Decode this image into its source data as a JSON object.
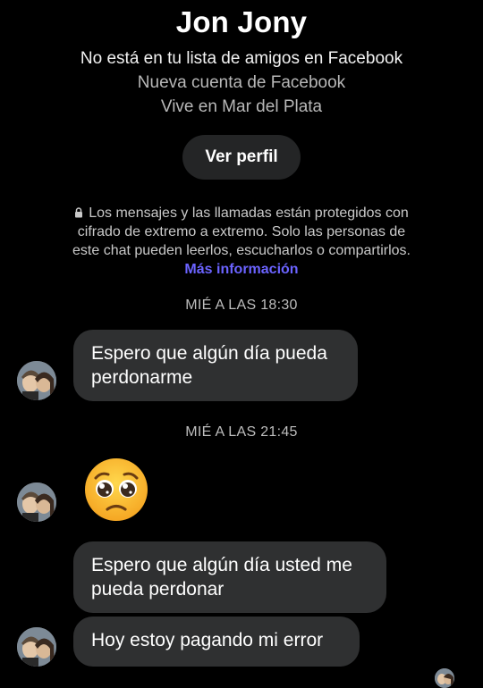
{
  "header": {
    "contact_name": "Jon Jony",
    "line1": "No está en tu lista de amigos en Facebook",
    "line2": "Nueva cuenta de Facebook",
    "line3": "Vive en Mar del Plata",
    "profile_button": "Ver perfil"
  },
  "encryption_notice": {
    "text": "Los mensajes y las llamadas están protegidos con cifrado de extremo a extremo. Solo las personas de este chat pueden leerlos, escucharlos o compartirlos.",
    "link": "Más información",
    "icon": "lock-icon"
  },
  "messages": {
    "ts1": "MIÉ A LAS 18:30",
    "m1": "Espero que algún día pueda perdonarme",
    "ts2": "MIÉ A LAS 21:45",
    "emoji_icon": "pleading-face-emoji",
    "m3": "Espero que algún día usted me pueda perdonar",
    "m4": "Hoy estoy pagando mi error"
  },
  "colors": {
    "background": "#000000",
    "bubble": "#2f3031",
    "button": "#242526",
    "link": "#6b63ff"
  }
}
